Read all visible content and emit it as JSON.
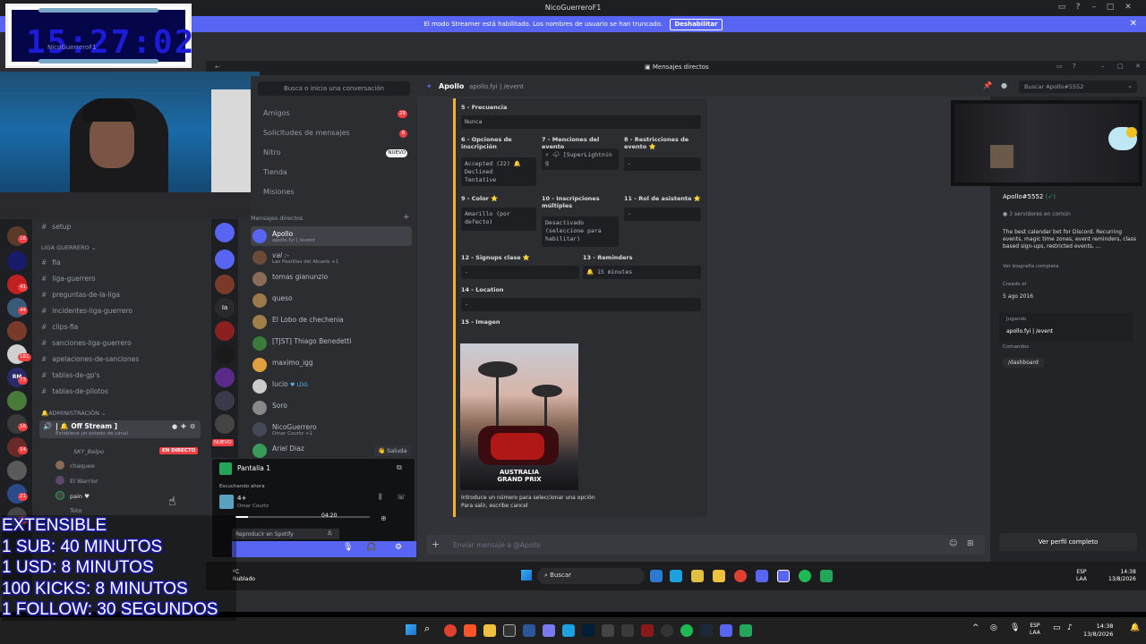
{
  "window": {
    "title": "NicoGuerreroF1"
  },
  "banner": {
    "text": "El modo Streamer está habilitado. Los nombres de usuario se han truncado.",
    "button": "Deshabilitar"
  },
  "timer": {
    "digits": "15:27:02",
    "user": "NicoGuerreroF1"
  },
  "secondary_window": {
    "title": "Mensajes directos"
  },
  "channels": {
    "items": [
      "setup",
      "fia",
      "liga-guerrero",
      "preguntas-de-la-liga",
      "incidentes-liga-guerrero",
      "clips-fia",
      "sanciones-liga-guerrero",
      "apelaciones-de-sanciones",
      "tablas-de-gp's",
      "tablas-de-pilotos"
    ],
    "category_liga": "LIGA GUERRERO",
    "category_admin": "ADMINISTRACIÓN",
    "voice_channel": "Off Stream",
    "voice_status": "Establece un estado de canal",
    "live_badge": "EN DIRECTO",
    "voice_users": [
      "SKY_Belpo",
      "chaquee",
      "El Warrior",
      "pain ♥",
      "Toto"
    ]
  },
  "guild_badges": [
    "16",
    "41",
    "44",
    "161",
    "73",
    "16",
    "14",
    "21",
    "34"
  ],
  "dm_sidebar": {
    "search": "Busca o inicia una conversación",
    "nav": [
      {
        "label": "Amigos",
        "badge": "29"
      },
      {
        "label": "Solicitudes de mensajes",
        "badge": "6"
      },
      {
        "label": "Nitro",
        "badge": "NUEVO"
      },
      {
        "label": "Tienda",
        "badge": ""
      },
      {
        "label": "Misiones",
        "badge": ""
      }
    ],
    "section": "Mensajes directos",
    "dms": [
      {
        "name": "Apollo",
        "sub": "apollo.fyi | /event",
        "color": "#5865f2"
      },
      {
        "name": "val :-",
        "sub": "Las Pastillas del Abuelo +1",
        "color": "#6b4a3a"
      },
      {
        "name": "tomas gianunzio",
        "sub": "",
        "color": "#8a6a58"
      },
      {
        "name": "queso",
        "sub": "",
        "color": "#9a7a4a"
      },
      {
        "name": "El Lobo de chechenia",
        "sub": "",
        "color": "#a0804a"
      },
      {
        "name": "[TJST] Thiago Benedetti",
        "sub": "",
        "color": "#3a7a3a"
      },
      {
        "name": "maximo_igg",
        "sub": "",
        "color": "#e0a040"
      },
      {
        "name": "lucio",
        "sub": "",
        "color": "#cccccc",
        "tag": "LDG"
      },
      {
        "name": "Soro",
        "sub": "",
        "color": "#888888"
      },
      {
        "name": "NicoGuerrero",
        "sub": "Omar Courtz +1",
        "color": "#444a55"
      },
      {
        "name": "Ariel Diaz",
        "sub": "",
        "color": "#3a9a5a"
      }
    ],
    "wave": "Saluda"
  },
  "chat": {
    "header_name": "Apollo",
    "header_sub": "apollo.fyi | /event",
    "search_placeholder": "Buscar Apollo#5552",
    "input_placeholder": "Enviar mensaje a @Apollo",
    "embed": {
      "f5_label": "5 - Frecuencia",
      "f5_value": "Nunca",
      "f6_label": "6 - Opciones de inscripción",
      "f6_value": [
        "Accepted (22) 🔔",
        "Declined",
        "Tentative"
      ],
      "f7_label": "7 - Menciones del evento",
      "f7_value": "⚡ 🌩 [SuperLightnin g",
      "f8_label": "8 - Restricciones de evento ⭐",
      "f8_value": "-",
      "f9_label": "9 - Color ⭐",
      "f9_value": "Amarillo (por defecto)",
      "f10_label": "10 - Inscripciones múltiples",
      "f10_value": "Desactivado (seleccione para habilitar)",
      "f11_label": "11 - Rol de asistente ⭐",
      "f11_value": "-",
      "f12_label": "12 - Signups clase ⭐",
      "f12_value": "-",
      "f13_label": "13 - Reminders",
      "f13_value": "🔔 15 minutes",
      "f14_label": "14 - Location",
      "f14_value": "-",
      "f15_label": "15 - Imagen",
      "poster_text": [
        "AUSTRALIA",
        "GRAND PRIX"
      ],
      "footer": [
        "Introduce un número para seleccionar una opción",
        "Para salir, escribe cancel"
      ]
    }
  },
  "profile": {
    "handle": "Apollo#5552",
    "servers": "3 servidores en común",
    "bio": "The best calendar bot for Discord. Recurring events, magic time zones, event reminders, class based sign-ups, restricted events, ...",
    "bio_link": "Ver biografía completa",
    "created_label": "Creado el",
    "created": "5 ago 2016",
    "playing_label": "Jugando",
    "playing": "apollo.fyi | /event",
    "commands_label": "Comandos",
    "command": "/dashboard",
    "full_profile": "Ver perfil completo"
  },
  "popup": {
    "screen": "Pantalla 1",
    "listening": "Escuchando ahora",
    "track": "4+",
    "artist": "Omar Courtz",
    "time": "04:20",
    "spotify": "Reproducir en Spotify"
  },
  "taskbar_inner": {
    "search": "Buscar",
    "weather": "ºC",
    "weather_sub": "Nublado",
    "lang": "ESP",
    "lang_sub": "LAA",
    "time": "14:38",
    "date": "13/8/2026"
  },
  "taskbar_outer": {
    "lang": "ESP",
    "lang_sub": "LAA",
    "time": "14:38",
    "date": "13/8/2026"
  },
  "overlay": [
    "EXTENSIBLE",
    "1 SUB: 40 MINUTOS",
    "1 USD: 8 MINUTOS",
    "100 KICKS: 8 MINUTOS",
    "1 FOLLOW: 30 SEGUNDOS"
  ],
  "colors": {
    "accent": "#5865f2",
    "embed_bar": "#f0b232",
    "live": "#f23f43",
    "overlay_stroke": "#1a1aa0"
  }
}
